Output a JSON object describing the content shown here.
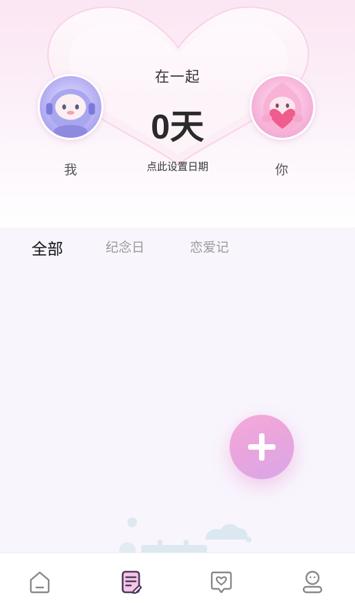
{
  "header": {
    "together_label": "在一起",
    "days_count": "0天",
    "set_date_hint": "点此设置日期",
    "me_label": "我",
    "you_label": "你",
    "me_avatar_icon": "blue-astronaut-avatar",
    "you_avatar_icon": "pink-heart-avatar"
  },
  "tabs": [
    {
      "label": "全部",
      "active": true
    },
    {
      "label": "纪念日",
      "active": false
    },
    {
      "label": "恋爱记",
      "active": false
    }
  ],
  "fab": {
    "icon": "plus-icon"
  },
  "tabbar": {
    "items": [
      {
        "icon": "home-icon",
        "active": false
      },
      {
        "icon": "notes-icon",
        "active": true
      },
      {
        "icon": "heart-chat-icon",
        "active": false
      },
      {
        "icon": "profile-icon",
        "active": false
      }
    ]
  },
  "colors": {
    "accent_pink": "#f2a6d8",
    "active_tab": "#111111",
    "inactive_tab": "#999999",
    "tab_icon_active": "#5a4468",
    "tab_icon_inactive": "#888888"
  }
}
